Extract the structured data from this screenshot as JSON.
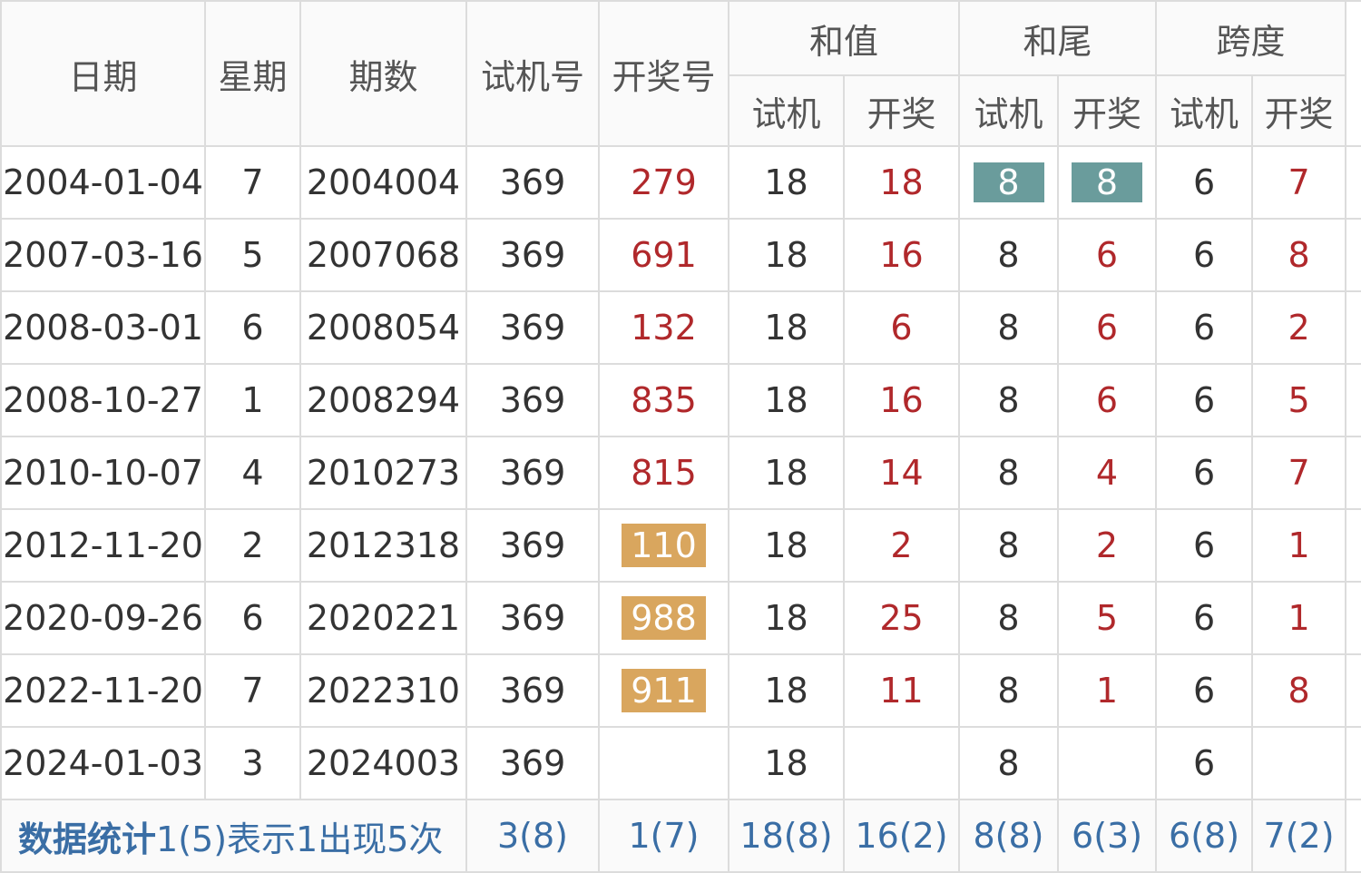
{
  "header": {
    "date": "日期",
    "weekday": "星期",
    "issue": "期数",
    "trial_number": "试机号",
    "draw_number": "开奖号",
    "sum_group": "和值",
    "tail_group": "和尾",
    "span_group": "跨度",
    "sub_trial": "试机",
    "sub_draw": "开奖"
  },
  "rows": [
    {
      "date": "2004-01-04",
      "weekday": "7",
      "issue": "2004004",
      "trial": "369",
      "draw": "279",
      "sum_trial": "18",
      "sum_draw": "18",
      "tail_trial": "8",
      "tail_draw": "8",
      "span_trial": "6",
      "span_draw": "7"
    },
    {
      "date": "2007-03-16",
      "weekday": "5",
      "issue": "2007068",
      "trial": "369",
      "draw": "691",
      "sum_trial": "18",
      "sum_draw": "16",
      "tail_trial": "8",
      "tail_draw": "6",
      "span_trial": "6",
      "span_draw": "8"
    },
    {
      "date": "2008-03-01",
      "weekday": "6",
      "issue": "2008054",
      "trial": "369",
      "draw": "132",
      "sum_trial": "18",
      "sum_draw": "6",
      "tail_trial": "8",
      "tail_draw": "6",
      "span_trial": "6",
      "span_draw": "2"
    },
    {
      "date": "2008-10-27",
      "weekday": "1",
      "issue": "2008294",
      "trial": "369",
      "draw": "835",
      "sum_trial": "18",
      "sum_draw": "16",
      "tail_trial": "8",
      "tail_draw": "6",
      "span_trial": "6",
      "span_draw": "5"
    },
    {
      "date": "2010-10-07",
      "weekday": "4",
      "issue": "2010273",
      "trial": "369",
      "draw": "815",
      "sum_trial": "18",
      "sum_draw": "14",
      "tail_trial": "8",
      "tail_draw": "4",
      "span_trial": "6",
      "span_draw": "7"
    },
    {
      "date": "2012-11-20",
      "weekday": "2",
      "issue": "2012318",
      "trial": "369",
      "draw": "110",
      "sum_trial": "18",
      "sum_draw": "2",
      "tail_trial": "8",
      "tail_draw": "2",
      "span_trial": "6",
      "span_draw": "1"
    },
    {
      "date": "2020-09-26",
      "weekday": "6",
      "issue": "2020221",
      "trial": "369",
      "draw": "988",
      "sum_trial": "18",
      "sum_draw": "25",
      "tail_trial": "8",
      "tail_draw": "5",
      "span_trial": "6",
      "span_draw": "1"
    },
    {
      "date": "2022-11-20",
      "weekday": "7",
      "issue": "2022310",
      "trial": "369",
      "draw": "911",
      "sum_trial": "18",
      "sum_draw": "11",
      "tail_trial": "8",
      "tail_draw": "1",
      "span_trial": "6",
      "span_draw": "8"
    },
    {
      "date": "2024-01-03",
      "weekday": "3",
      "issue": "2024003",
      "trial": "369",
      "draw": "",
      "sum_trial": "18",
      "sum_draw": "",
      "tail_trial": "8",
      "tail_draw": "",
      "span_trial": "6",
      "span_draw": ""
    }
  ],
  "stats": {
    "title": "数据统计",
    "note": "1(5)表示1出现5次",
    "trial": "3(8)",
    "draw": "1(7)",
    "sum_trial": "18(8)",
    "sum_draw": "16(2)",
    "tail_trial": "8(8)",
    "tail_draw": "6(3)",
    "span_trial": "6(8)",
    "span_draw": "7(2)"
  },
  "colors": {
    "draw_text": "#b0282b",
    "stats_text": "#3a6ea5",
    "highlight_orange": "#d9a65e",
    "highlight_teal": "#6a9c9c",
    "grid": "#dcdcdc"
  }
}
